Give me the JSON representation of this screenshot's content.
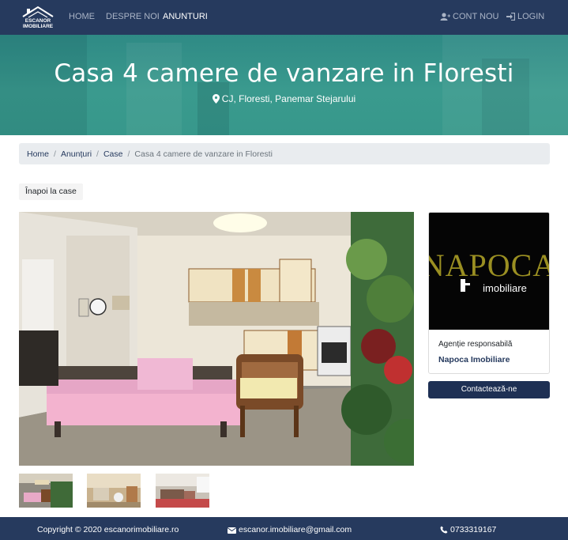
{
  "brand": {
    "logo_line1": "ESCANOR",
    "logo_line2": "IMOBILIARE"
  },
  "nav": {
    "home": "HOME",
    "about": "DESPRE NOI",
    "ads": "ANUNTURI",
    "account": "CONT NOU",
    "login": "LOGIN"
  },
  "hero": {
    "title": "Casa 4 camere de vanzare in Floresti",
    "location": "CJ, Floresti, Panemar Stejarului"
  },
  "breadcrumb": {
    "items": [
      "Home",
      "Anunțuri",
      "Case"
    ],
    "current": "Casa 4 camere de vanzare in Floresti",
    "separator": "/"
  },
  "back_button": "Înapoi la case",
  "agency": {
    "logo_text_main": "NAPOCA",
    "logo_text_sub": "imobiliare",
    "label": "Agenție responsabilă",
    "name": "Napoca Imobiliare"
  },
  "contact_button": "Contactează-ne",
  "footer": {
    "copyright": "Copyright © 2020 escanorimobiliare.ro",
    "email": "escanor.imobiliare@gmail.com",
    "phone": "0733319167"
  },
  "colors": {
    "navbar": "#263a5e",
    "hero": "#3a9a8e",
    "accent": "#1e3054",
    "agency_logo_gold": "#9a8f22"
  },
  "icons": [
    "user-plus-icon",
    "sign-in-icon",
    "map-marker-icon",
    "envelope-icon",
    "phone-icon"
  ]
}
